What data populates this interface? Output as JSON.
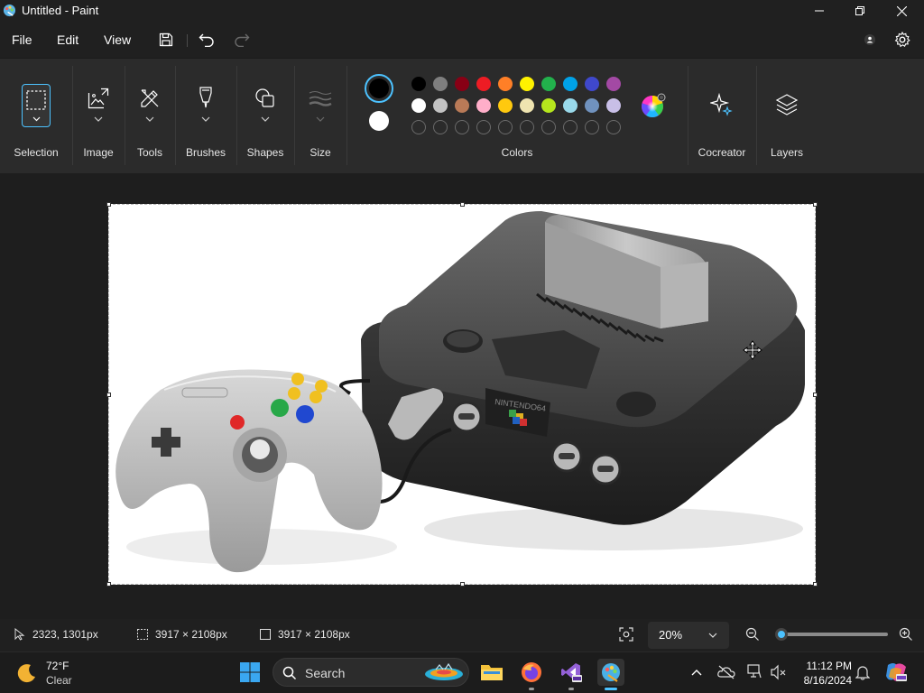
{
  "window": {
    "title": "Untitled - Paint"
  },
  "menu": {
    "file": "File",
    "edit": "Edit",
    "view": "View"
  },
  "ribbon": {
    "selection": "Selection",
    "image": "Image",
    "tools": "Tools",
    "brushes": "Brushes",
    "shapes": "Shapes",
    "size": "Size",
    "colors": "Colors",
    "cocreator": "Cocreator",
    "layers": "Layers"
  },
  "colors": {
    "primary": "#000000",
    "secondary": "#ffffff",
    "palette_row1": [
      "#000000",
      "#7f7f7f",
      "#880015",
      "#ed1c24",
      "#ff7f27",
      "#fff200",
      "#22b14c",
      "#00a2e8",
      "#3f48cc",
      "#a349a4"
    ],
    "palette_row2": [
      "#ffffff",
      "#c3c3c3",
      "#b97a57",
      "#ffaec9",
      "#ffc90e",
      "#efe4b0",
      "#b5e61d",
      "#99d9ea",
      "#7092be",
      "#c8bfe7"
    ],
    "custom_slots": 10,
    "accent": "#4cc2ff"
  },
  "status": {
    "cursor_position": "2323, 1301px",
    "selection_size": "3917 × 2108px",
    "canvas_size": "3917 × 2108px",
    "zoom": "20%",
    "zoom_level": 0.2
  },
  "taskbar": {
    "weather_temp": "72°F",
    "weather_desc": "Clear",
    "search_placeholder": "Search",
    "time": "11:12 PM",
    "date": "8/16/2024"
  },
  "canvas": {
    "logo_text": "NINTENDO64"
  }
}
